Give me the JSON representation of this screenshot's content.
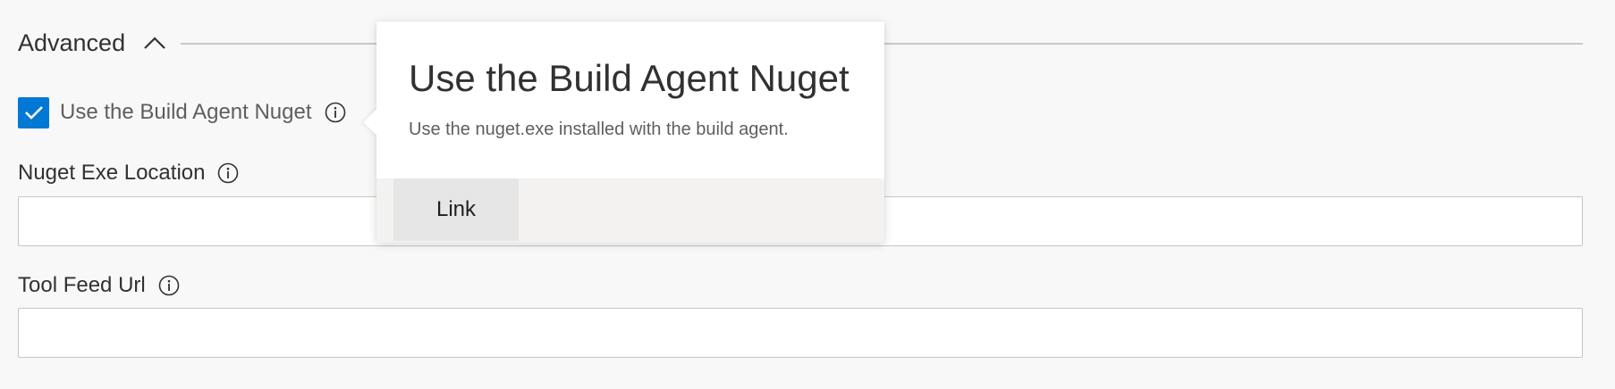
{
  "section": {
    "title": "Advanced",
    "chevron_icon": "chevron-up-icon"
  },
  "use_build_agent": {
    "label": "Use the Build Agent Nuget",
    "checked": true,
    "check_icon": "checkmark-icon",
    "info_icon": "info-icon"
  },
  "nuget_exe_location": {
    "label": "Nuget Exe Location",
    "value": "",
    "info_icon": "info-icon"
  },
  "tool_feed_url": {
    "label": "Tool Feed Url",
    "value": "",
    "info_icon": "info-icon"
  },
  "callout": {
    "title": "Use the Build Agent Nuget",
    "description": "Use the nuget.exe installed with the build agent.",
    "link_label": "Link"
  },
  "colors": {
    "accent": "#0078d4",
    "background": "#f8f8f8",
    "text": "#323130",
    "secondary_text": "#605e5c"
  }
}
